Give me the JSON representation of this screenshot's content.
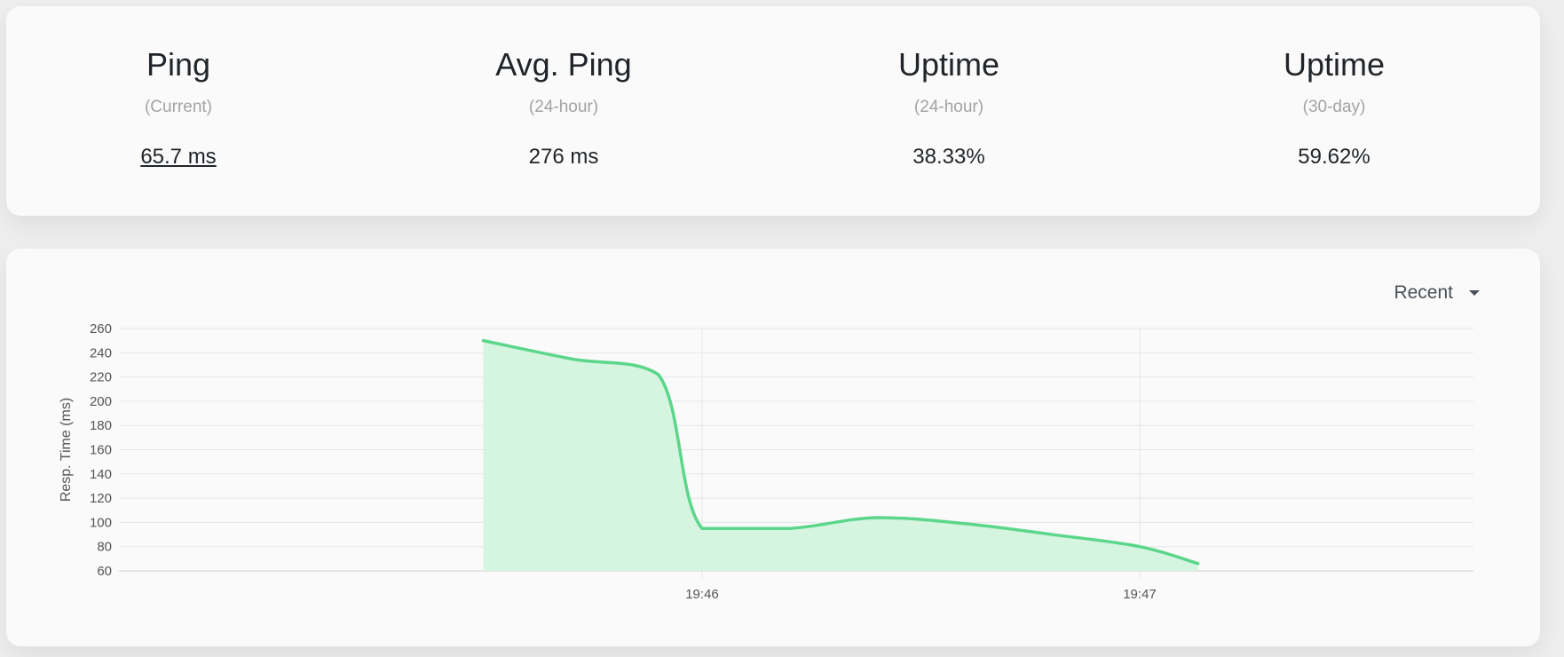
{
  "stats": [
    {
      "title": "Ping",
      "subtitle": "(Current)",
      "value": "65.7 ms"
    },
    {
      "title": "Avg. Ping",
      "subtitle": "(24-hour)",
      "value": "276 ms"
    },
    {
      "title": "Uptime",
      "subtitle": "(24-hour)",
      "value": "38.33%"
    },
    {
      "title": "Uptime",
      "subtitle": "(30-day)",
      "value": "59.62%"
    }
  ],
  "period_select": {
    "value": "Recent"
  },
  "colors": {
    "line": "#5cd68a",
    "fill": "#d6f5e1",
    "grid": "#e6e6e6",
    "tick_text": "#555555"
  },
  "chart_data": {
    "type": "area",
    "ylabel": "Resp. Time (ms)",
    "ylim": [
      60,
      260
    ],
    "yticks": [
      60,
      80,
      100,
      120,
      140,
      160,
      180,
      200,
      220,
      240,
      260
    ],
    "xticks": [
      "19:46",
      "19:47"
    ],
    "series": [
      {
        "x": [
          "19:45:30",
          "19:45:42",
          "19:45:54",
          "19:46:00",
          "19:46:12",
          "19:46:24",
          "19:46:36",
          "19:46:48",
          "19:47:00",
          "19:47:08"
        ],
        "values": [
          250,
          235,
          222,
          95,
          95,
          104,
          99,
          90,
          80,
          66
        ]
      }
    ],
    "grid": true,
    "legend": false
  }
}
